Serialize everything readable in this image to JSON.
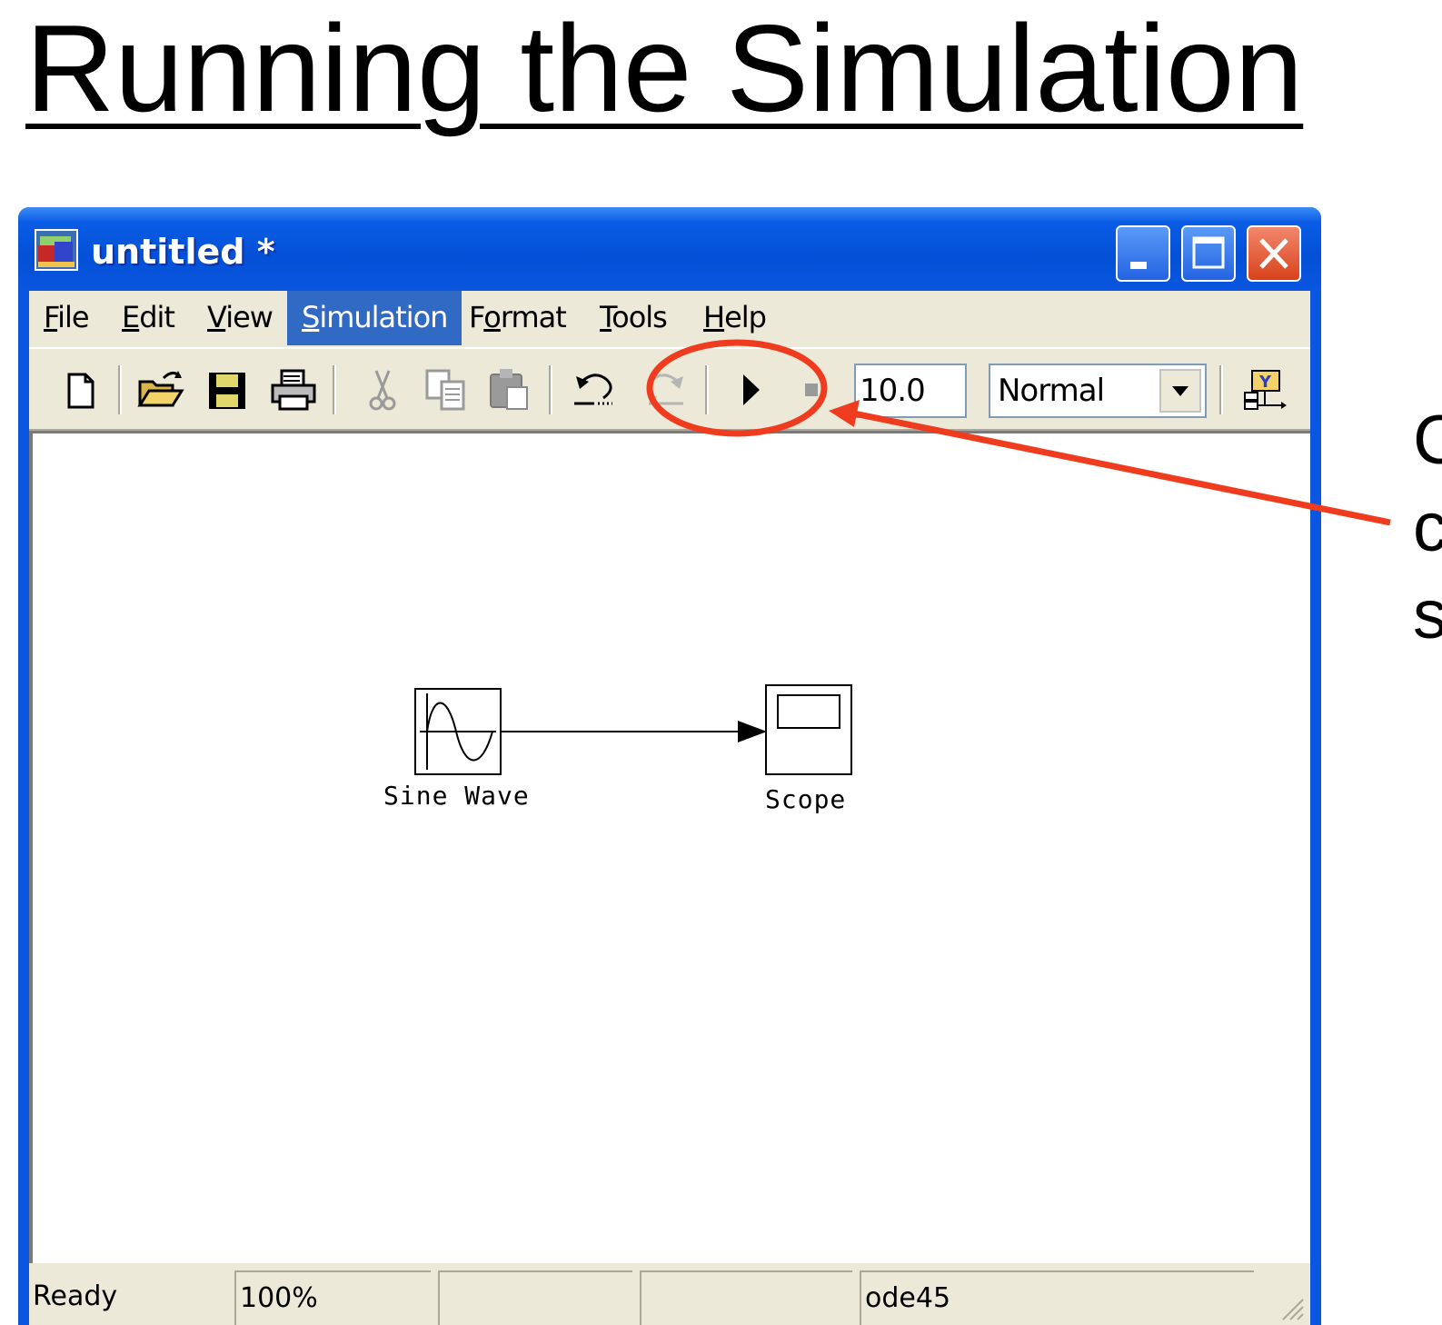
{
  "slide": {
    "title": "Running the Simulation",
    "callout_lines": [
      "C",
      "c",
      "s"
    ]
  },
  "window": {
    "title": "untitled *",
    "controls": [
      "minimize-icon",
      "maximize-icon",
      "close-icon"
    ]
  },
  "menu": {
    "items": [
      {
        "label": "File",
        "mnemonic": "F"
      },
      {
        "label": "Edit",
        "mnemonic": "E"
      },
      {
        "label": "View",
        "mnemonic": "V"
      },
      {
        "label": "Simulation",
        "mnemonic": "S",
        "active": true
      },
      {
        "label": "Format",
        "mnemonic": "o"
      },
      {
        "label": "Tools",
        "mnemonic": "T"
      },
      {
        "label": "Help",
        "mnemonic": "H"
      }
    ]
  },
  "toolbar": {
    "icons": [
      "new-model-icon",
      "open-folder-icon",
      "save-icon",
      "print-icon",
      "cut-icon",
      "copy-icon",
      "paste-icon",
      "undo-icon",
      "redo-icon",
      "start-simulation-icon",
      "stop-simulation-icon",
      "library-browser-icon"
    ],
    "stop_time": "10.0",
    "simulation_mode": "Normal"
  },
  "model": {
    "blocks": [
      {
        "name": "Sine Wave"
      },
      {
        "name": "Scope"
      }
    ]
  },
  "status": {
    "ready": "Ready",
    "zoom": "100%",
    "solver": "ode45"
  },
  "colors": {
    "titlebar": "#0a56e0",
    "menu_highlight": "#316ac5",
    "annotation": "#f03c1e",
    "window_face": "#ece9d8"
  }
}
